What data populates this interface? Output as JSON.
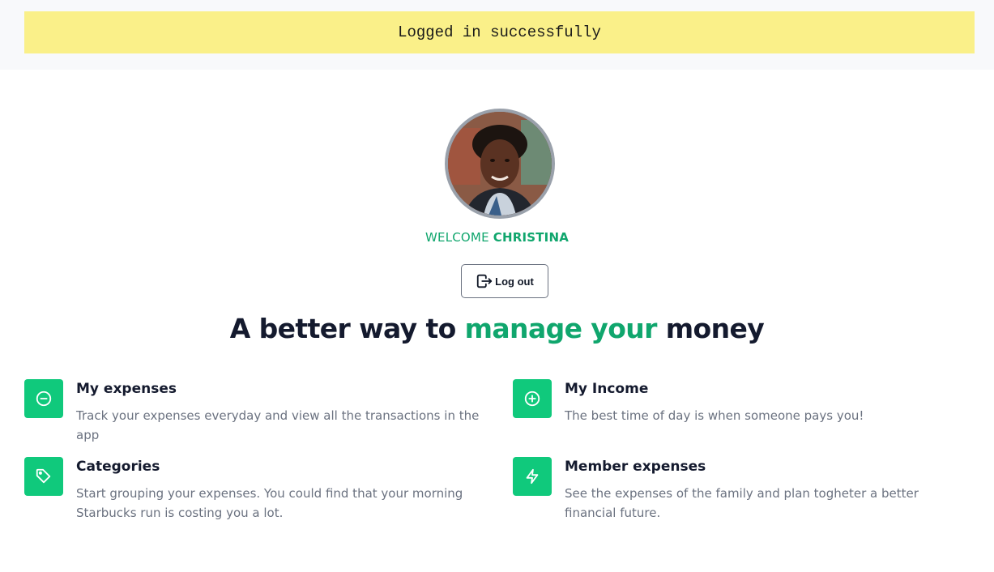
{
  "alert": {
    "message": "Logged in successfully"
  },
  "profile": {
    "welcome_prefix": "WELCOME",
    "username": "CHRISTINA",
    "avatar_alt": "Profile photo"
  },
  "actions": {
    "logout_label": "Log out",
    "logout_icon": "logout-icon"
  },
  "hero": {
    "headline_start": "A better way to",
    "headline_accent": "manage your",
    "headline_end": "money"
  },
  "features": [
    {
      "icon": "minus-circle-icon",
      "title": "My expenses",
      "description": "Track your expenses everyday and view all the transactions in the app"
    },
    {
      "icon": "plus-circle-icon",
      "title": "My Income",
      "description": "The best time of day is when someone pays you!"
    },
    {
      "icon": "tag-icon",
      "title": "Categories",
      "description": "Start grouping your expenses. You could find that your morning Starbucks run is costing you a lot."
    },
    {
      "icon": "lightning-icon",
      "title": "Member expenses",
      "description": "See the expenses of the family and plan togheter a better financial future."
    }
  ],
  "colors": {
    "accent": "#10a66d",
    "feature_icon_bg": "#10c97c",
    "alert_bg": "#faf089",
    "heading": "#141a2e",
    "muted_text": "#6b7280"
  }
}
